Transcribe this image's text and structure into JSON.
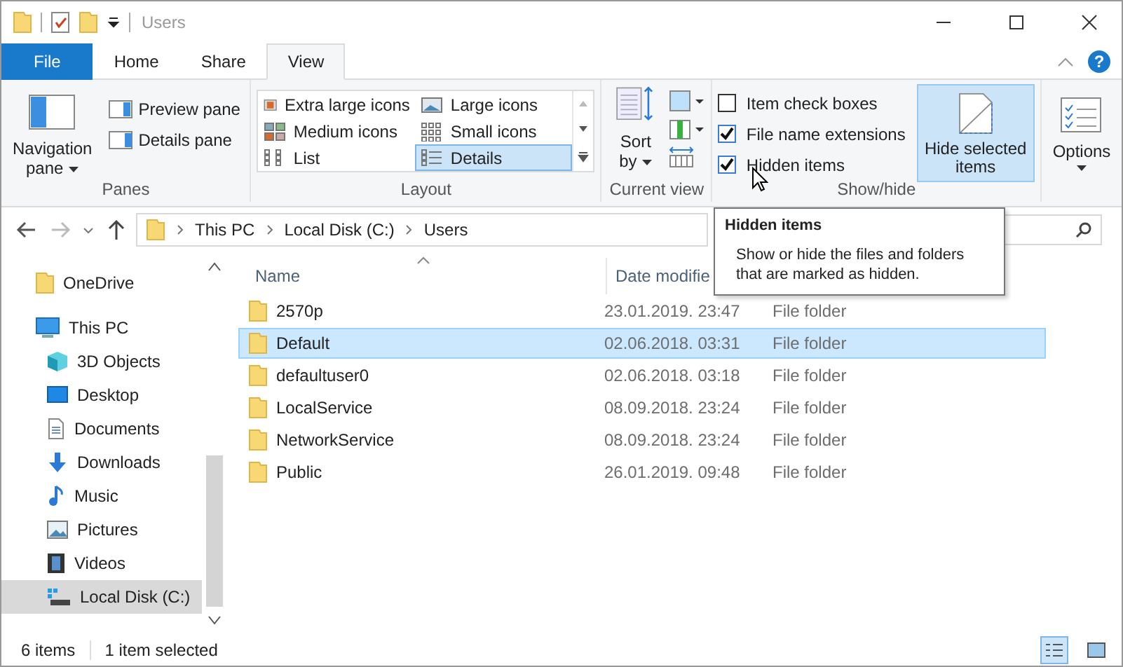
{
  "window": {
    "title": "Users"
  },
  "ribbon_tabs": [
    {
      "label": "File",
      "kind": "file",
      "selected": false
    },
    {
      "label": "Home",
      "kind": "tab",
      "selected": false
    },
    {
      "label": "Share",
      "kind": "tab",
      "selected": false
    },
    {
      "label": "View",
      "kind": "tab",
      "selected": true
    }
  ],
  "help": "?",
  "panes": {
    "group": "Panes",
    "navigation": "Navigation pane",
    "buttons": [
      {
        "label": "Preview pane",
        "kind": "preview"
      },
      {
        "label": "Details pane",
        "kind": "details"
      }
    ]
  },
  "layout": {
    "group": "Layout",
    "items": [
      {
        "label": "Extra large icons",
        "kind": "xl",
        "selected": false
      },
      {
        "label": "Large icons",
        "kind": "large",
        "selected": false
      },
      {
        "label": "Medium icons",
        "kind": "medium",
        "selected": false
      },
      {
        "label": "Small icons",
        "kind": "small",
        "selected": false
      },
      {
        "label": "List",
        "kind": "list",
        "selected": false
      },
      {
        "label": "Details",
        "kind": "details",
        "selected": true
      }
    ]
  },
  "current_view": {
    "group": "Current view",
    "sort": "Sort by"
  },
  "show_hide": {
    "group": "Show/hide",
    "checkboxes": [
      {
        "label": "Item check boxes",
        "checked": false
      },
      {
        "label": "File name extensions",
        "checked": true
      },
      {
        "label": "Hidden items",
        "checked": true
      }
    ],
    "hide_selected": {
      "label": "Hide selected items",
      "selected": true
    }
  },
  "options": {
    "label": "Options"
  },
  "address": {
    "crumbs": [
      "This PC",
      "Local Disk (C:)",
      "Users"
    ]
  },
  "nav_pane": [
    {
      "label": "OneDrive",
      "kind": "folder",
      "selected": false
    },
    {
      "label": "This PC",
      "kind": "pc",
      "selected": false,
      "children": [
        {
          "label": "3D Objects",
          "kind": "cube",
          "selected": false
        },
        {
          "label": "Desktop",
          "kind": "desktop",
          "selected": false
        },
        {
          "label": "Documents",
          "kind": "doc",
          "selected": false
        },
        {
          "label": "Downloads",
          "kind": "download",
          "selected": false
        },
        {
          "label": "Music",
          "kind": "music",
          "selected": false
        },
        {
          "label": "Pictures",
          "kind": "pictures",
          "selected": false
        },
        {
          "label": "Videos",
          "kind": "videos",
          "selected": false
        },
        {
          "label": "Local Disk (C:)",
          "kind": "disk",
          "selected": true
        }
      ]
    }
  ],
  "columns": [
    "Name",
    "Date modifie"
  ],
  "files": [
    {
      "name": "2570p",
      "date": "23.01.2019. 23:47",
      "type": "File folder",
      "selected": false
    },
    {
      "name": "Default",
      "date": "02.06.2018. 03:31",
      "type": "File folder",
      "selected": true
    },
    {
      "name": "defaultuser0",
      "date": "02.06.2018. 03:18",
      "type": "File folder",
      "selected": false
    },
    {
      "name": "LocalService",
      "date": "08.09.2018. 23:24",
      "type": "File folder",
      "selected": false
    },
    {
      "name": "NetworkService",
      "date": "08.09.2018. 23:24",
      "type": "File folder",
      "selected": false
    },
    {
      "name": "Public",
      "date": "26.01.2019. 09:48",
      "type": "File folder",
      "selected": false
    }
  ],
  "status": {
    "count": "6 items",
    "selection": "1 item selected"
  },
  "view_toggles": [
    {
      "kind": "details",
      "selected": true
    },
    {
      "kind": "large",
      "selected": false
    }
  ],
  "tooltip": {
    "title": "Hidden items",
    "text": "Show or hide the files and folders that are marked as hidden."
  }
}
